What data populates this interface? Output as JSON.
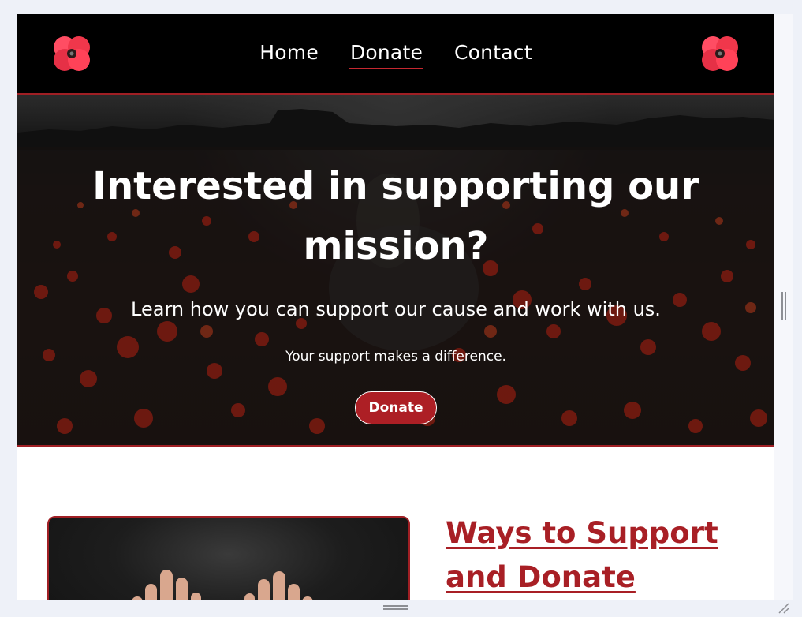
{
  "nav": {
    "links": [
      {
        "label": "Home",
        "active": false
      },
      {
        "label": "Donate",
        "active": true
      },
      {
        "label": "Contact",
        "active": false
      }
    ],
    "logo_icon": "poppy-icon"
  },
  "hero": {
    "title": "Interested in supporting our mission?",
    "subtitle": "Learn how you can support our cause and work with us.",
    "small_text": "Your support makes a difference.",
    "button_label": "Donate"
  },
  "section": {
    "heading": "Ways to Support and Donate"
  },
  "colors": {
    "accent": "#ad1f25",
    "nav_bg": "#000000",
    "poppy": "#f0374b"
  }
}
